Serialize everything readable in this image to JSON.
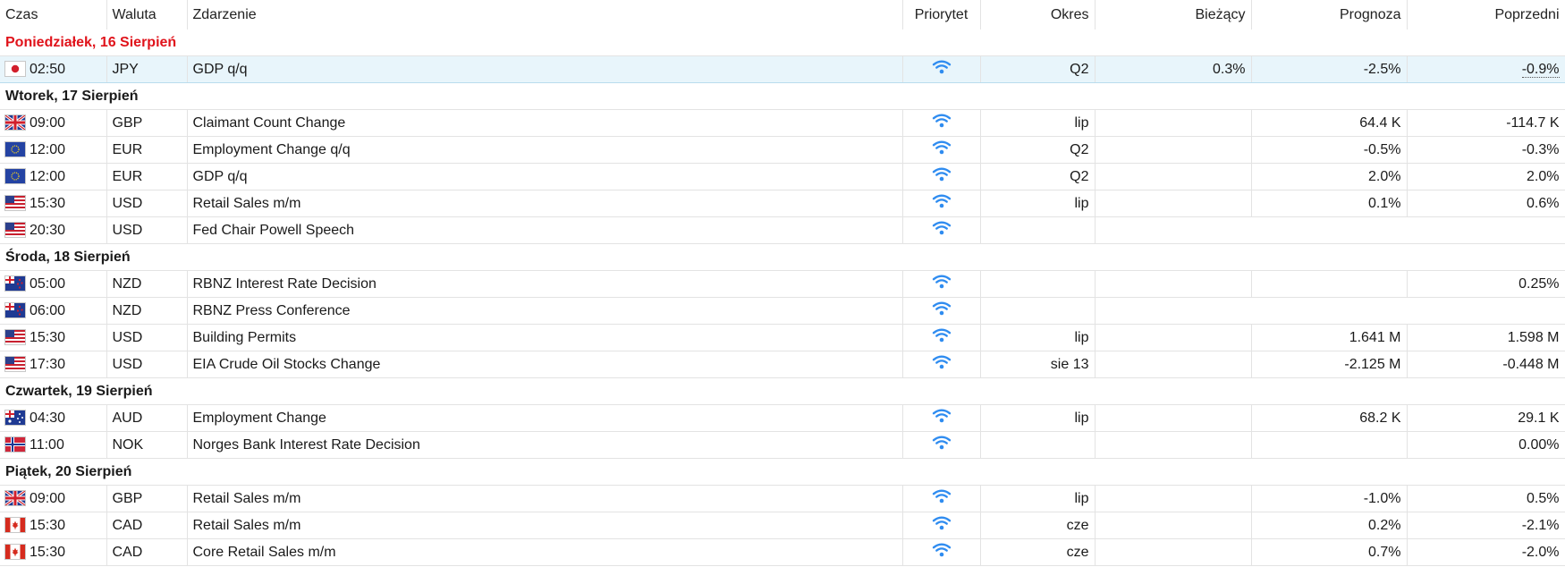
{
  "columns": {
    "time": "Czas",
    "currency": "Waluta",
    "event": "Zdarzenie",
    "priority": "Priorytet",
    "period": "Okres",
    "actual": "Bieżący",
    "forecast": "Prognoza",
    "previous": "Poprzedni"
  },
  "colors": {
    "today": "#e0131b",
    "priority_icon": "#2f8cf0",
    "selected_row": "#e8f5fb"
  },
  "days": [
    {
      "label": "Poniedziałek, 16 Sierpień",
      "today": true,
      "events": [
        {
          "flag": "jp-flag-icon",
          "time": "02:50",
          "currency": "JPY",
          "event": "GDP q/q",
          "period": "Q2",
          "actual": "0.3%",
          "forecast": "-2.5%",
          "previous": "-0.9%",
          "selected": true
        }
      ]
    },
    {
      "label": "Wtorek, 17 Sierpień",
      "events": [
        {
          "flag": "gb-flag-icon",
          "time": "09:00",
          "currency": "GBP",
          "event": "Claimant Count Change",
          "period": "lip",
          "actual": "",
          "forecast": "64.4 K",
          "previous": "-114.7 K"
        },
        {
          "flag": "eu-flag-icon",
          "time": "12:00",
          "currency": "EUR",
          "event": "Employment Change q/q",
          "period": "Q2",
          "actual": "",
          "forecast": "-0.5%",
          "previous": "-0.3%"
        },
        {
          "flag": "eu-flag-icon",
          "time": "12:00",
          "currency": "EUR",
          "event": "GDP q/q",
          "period": "Q2",
          "actual": "",
          "forecast": "2.0%",
          "previous": "2.0%"
        },
        {
          "flag": "us-flag-icon",
          "time": "15:30",
          "currency": "USD",
          "event": "Retail Sales m/m",
          "period": "lip",
          "actual": "",
          "forecast": "0.1%",
          "previous": "0.6%"
        },
        {
          "flag": "us-flag-icon",
          "time": "20:30",
          "currency": "USD",
          "event": "Fed Chair Powell Speech",
          "speech": true
        }
      ]
    },
    {
      "label": "Środa, 18 Sierpień",
      "events": [
        {
          "flag": "nz-flag-icon",
          "time": "05:00",
          "currency": "NZD",
          "event": "RBNZ Interest Rate Decision",
          "period": "",
          "actual": "",
          "forecast": "",
          "previous": "0.25%"
        },
        {
          "flag": "nz-flag-icon",
          "time": "06:00",
          "currency": "NZD",
          "event": "RBNZ Press Conference",
          "speech": true
        },
        {
          "flag": "us-flag-icon",
          "time": "15:30",
          "currency": "USD",
          "event": "Building Permits",
          "period": "lip",
          "actual": "",
          "forecast": "1.641 M",
          "previous": "1.598 M"
        },
        {
          "flag": "us-flag-icon",
          "time": "17:30",
          "currency": "USD",
          "event": "EIA Crude Oil Stocks Change",
          "period": "sie 13",
          "actual": "",
          "forecast": "-2.125 M",
          "previous": "-0.448 M"
        }
      ]
    },
    {
      "label": "Czwartek, 19 Sierpień",
      "events": [
        {
          "flag": "au-flag-icon",
          "time": "04:30",
          "currency": "AUD",
          "event": "Employment Change",
          "period": "lip",
          "actual": "",
          "forecast": "68.2 K",
          "previous": "29.1 K"
        },
        {
          "flag": "no-flag-icon",
          "time": "11:00",
          "currency": "NOK",
          "event": "Norges Bank Interest Rate Decision",
          "period": "",
          "actual": "",
          "forecast": "",
          "previous": "0.00%"
        }
      ]
    },
    {
      "label": "Piątek, 20 Sierpień",
      "events": [
        {
          "flag": "gb-flag-icon",
          "time": "09:00",
          "currency": "GBP",
          "event": "Retail Sales m/m",
          "period": "lip",
          "actual": "",
          "forecast": "-1.0%",
          "previous": "0.5%"
        },
        {
          "flag": "ca-flag-icon",
          "time": "15:30",
          "currency": "CAD",
          "event": "Retail Sales m/m",
          "period": "cze",
          "actual": "",
          "forecast": "0.2%",
          "previous": "-2.1%"
        },
        {
          "flag": "ca-flag-icon",
          "time": "15:30",
          "currency": "CAD",
          "event": "Core Retail Sales m/m",
          "period": "cze",
          "actual": "",
          "forecast": "0.7%",
          "previous": "-2.0%"
        }
      ]
    }
  ]
}
